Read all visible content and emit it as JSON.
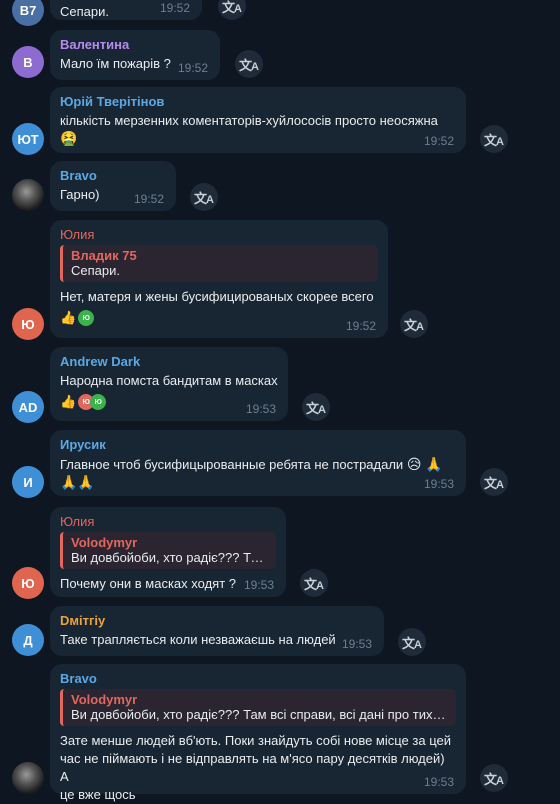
{
  "colors": {
    "background": "#0e1621",
    "bubble": "#182533",
    "time": "#6d7f8f",
    "quote_accent": "#e2675f"
  },
  "messages": [
    {
      "avatar": "B7",
      "avatar_color": "#4a6fa5",
      "text": "Сепари.",
      "time": "19:52"
    },
    {
      "avatar": "B",
      "avatar_color": "#8e6bd1",
      "name": "Валентина",
      "name_color": "#b88af0",
      "text": "Мало їм пожарів ?",
      "time": "19:52"
    },
    {
      "avatar": "ЮТ",
      "avatar_color": "#3f8fd6",
      "name": "Юрій Тверітінов",
      "name_color": "#5aa9e6",
      "text": "кількість мерзенних коментаторів-хуйлососів просто неосяжна",
      "emoji": "🤮",
      "time": "19:52"
    },
    {
      "avatar": "photo",
      "name": "Bravo",
      "name_color": "#5aa9e6",
      "text": "Гарно)",
      "time": "19:52"
    },
    {
      "avatar": "Ю",
      "avatar_color": "#e0654f",
      "name": "Юлия",
      "name_color": "#e2675f",
      "quote_name": "Владик 75",
      "quote_text": "Сепари.",
      "text": "Нет, матеря и жены бусифицированых скорее всего",
      "reactions": [
        "👍",
        "Ю"
      ],
      "time": "19:52"
    },
    {
      "avatar": "AD",
      "avatar_color": "#3f8fd6",
      "name": "Andrew Dark",
      "name_color": "#5aa9e6",
      "text": "Народна помста бандитам в масках",
      "reactions": [
        "👍",
        "Ю",
        "Ю"
      ],
      "time": "19:53"
    },
    {
      "avatar": "И",
      "avatar_color": "#3f8fd6",
      "name": "Ирусик",
      "name_color": "#5aa9e6",
      "text": "Главное чтоб бусифицырованные ребята не пострадали",
      "emoji_line1": "😥 🙏",
      "emoji_line2": "🙏🙏",
      "time": "19:53"
    },
    {
      "avatar": "Ю",
      "avatar_color": "#e0654f",
      "name": "Юлия",
      "name_color": "#e2675f",
      "quote_name": "Volodymyr",
      "quote_text": "Ви довбойоби, хто радіє??? Там...",
      "text": "Почему они в масках ходят ?",
      "time": "19:53"
    },
    {
      "avatar": "Д",
      "avatar_color": "#3f8fd6",
      "name": "Dмітгіу",
      "name_color": "#e8a33d",
      "text": "Таке трапляється коли незважаєшь на людей",
      "time": "19:53"
    },
    {
      "avatar": "photo",
      "name": "Bravo",
      "name_color": "#5aa9e6",
      "quote_name": "Volodymyr",
      "quote_text": "Ви довбойоби, хто радіє??? Там всі справи, всі дані про тих, хт...",
      "text_lines": [
        "Зате менше людей вб'ють. Поки знайдуть собі нове місце за цей",
        "час не піймають і не відправлять на м'ясо пару десятків людей) А",
        "це вже щось"
      ],
      "time": "19:53"
    }
  ]
}
